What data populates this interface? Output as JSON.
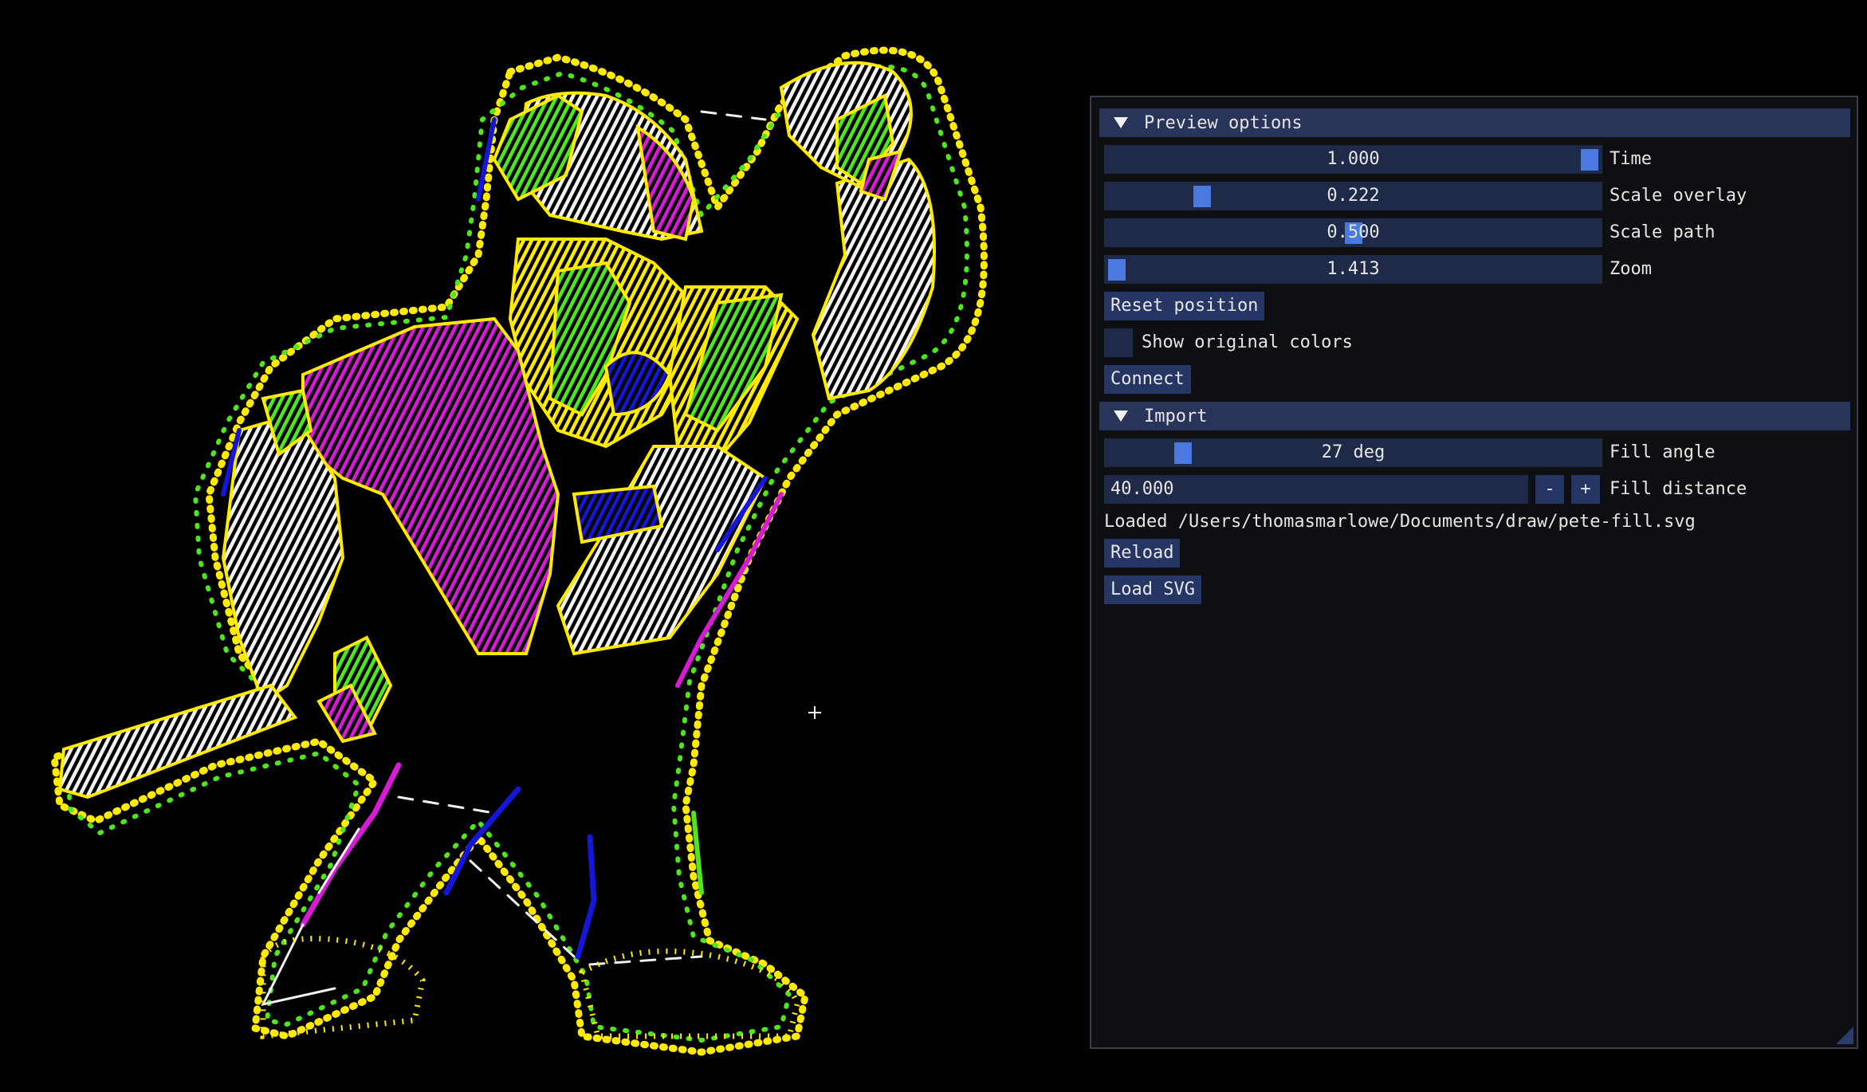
{
  "preview_options": {
    "header_label": "Preview options",
    "sliders": [
      {
        "value": "1.000",
        "label": "Time",
        "fraction": 1.0
      },
      {
        "value": "0.222",
        "label": "Scale overlay",
        "fraction": 0.18
      },
      {
        "value": "0.500",
        "label": "Scale path",
        "fraction": 0.5
      },
      {
        "value": "1.413",
        "label": "Zoom",
        "fraction": 0.0
      }
    ],
    "reset_button": "Reset position",
    "show_colors_label": "Show original colors",
    "connect_button": "Connect"
  },
  "import": {
    "header_label": "Import",
    "fill_angle": {
      "value": "27 deg",
      "label": "Fill angle",
      "fraction": 0.14
    },
    "fill_distance": {
      "value": "40.000",
      "label": "Fill distance",
      "minus": "-",
      "plus": "+"
    },
    "loaded_text": "Loaded /Users/thomasmarlowe/Documents/draw/pete-fill.svg",
    "reload_button": "Reload",
    "load_svg_button": "Load SVG"
  },
  "colors": {
    "yellow": "#ffea00",
    "magenta": "#d61ad6",
    "green": "#4ee61c",
    "white": "#f2f2f2",
    "blue": "#1616d8",
    "accent": "#4a7ae0"
  }
}
